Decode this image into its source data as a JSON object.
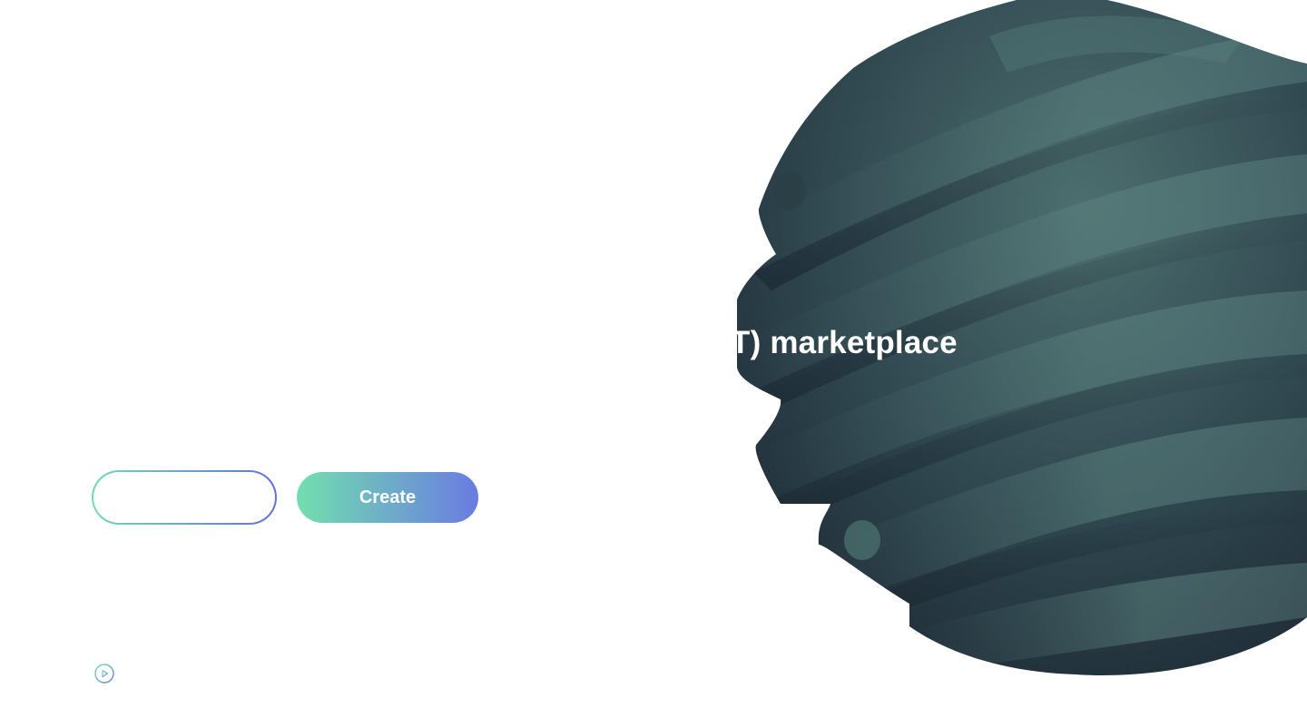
{
  "hero": {
    "headline_visible": "T) marketplace"
  },
  "actions": {
    "secondary_label": "",
    "create_label": "Create"
  },
  "video": {
    "icon": "play-circle-icon"
  },
  "colors": {
    "gradient_start": "#72dfae",
    "gradient_end": "#6a7be2",
    "sphere_dark": "#22303a",
    "sphere_light": "#4f7270"
  }
}
